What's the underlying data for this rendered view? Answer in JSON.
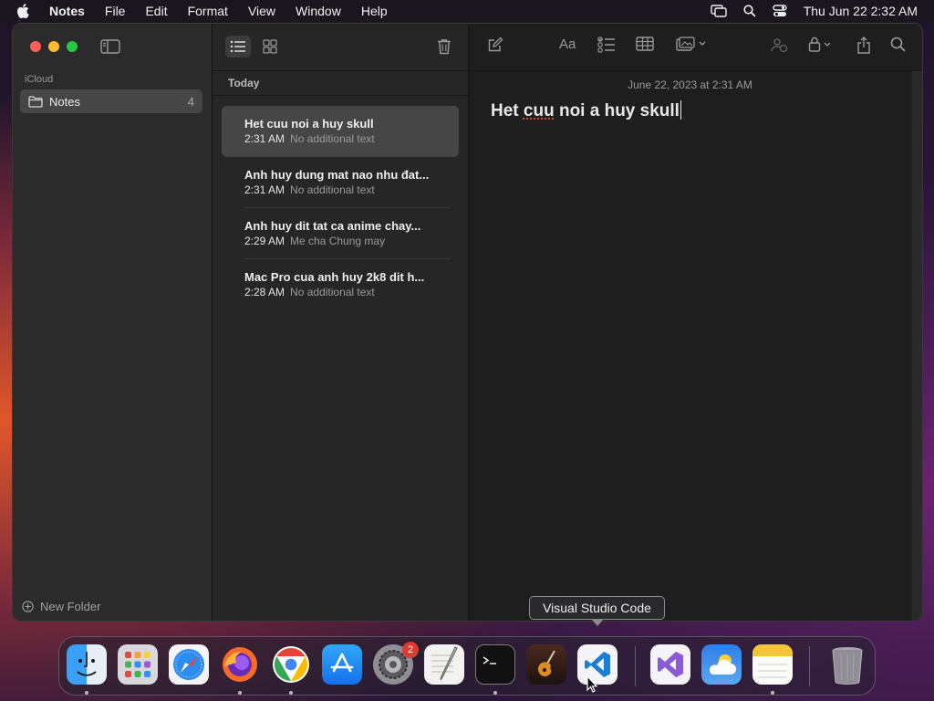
{
  "menubar": {
    "app_name": "Notes",
    "items": [
      "File",
      "Edit",
      "Format",
      "View",
      "Window",
      "Help"
    ],
    "clock": "Thu Jun 22  2:32 AM"
  },
  "sidebar": {
    "account_label": "iCloud",
    "folder": {
      "name": "Notes",
      "count": "4"
    },
    "new_folder_label": "New Folder"
  },
  "note_list": {
    "section_label": "Today",
    "notes": [
      {
        "title": "Het cuu noi a huy skull",
        "time": "2:31 AM",
        "preview": "No additional text",
        "selected": true
      },
      {
        "title": "Anh huy dung mat nao nhu đat...",
        "time": "2:31 AM",
        "preview": "No additional text",
        "selected": false
      },
      {
        "title": "Anh huy dit tat ca anime chay...",
        "time": "2:29 AM",
        "preview": "Me cha Chung may",
        "selected": false
      },
      {
        "title": "Mac Pro cua anh huy 2k8 dit h...",
        "time": "2:28 AM",
        "preview": "No additional text",
        "selected": false
      }
    ]
  },
  "editor": {
    "date": "June 22, 2023 at 2:31 AM",
    "title_part1": "Het ",
    "title_misspelled": "cuu",
    "title_part2": " noi a huy skull"
  },
  "tooltip": {
    "text": "Visual Studio Code"
  },
  "dock": {
    "apps": [
      "finder-icon",
      "launchpad-icon",
      "safari-icon",
      "firefox-icon",
      "chrome-icon",
      "app-store-icon",
      "system-settings-icon",
      "textedit-icon",
      "terminal-icon",
      "garageband-icon",
      "vscode-icon",
      "visual-studio-icon",
      "weather-icon",
      "notes-icon",
      "trash-icon"
    ],
    "settings_badge": "2"
  },
  "colors": {
    "close": "#ff5f57",
    "minimize": "#febc2e",
    "zoom": "#28c840",
    "accent_selection": "#464646"
  }
}
